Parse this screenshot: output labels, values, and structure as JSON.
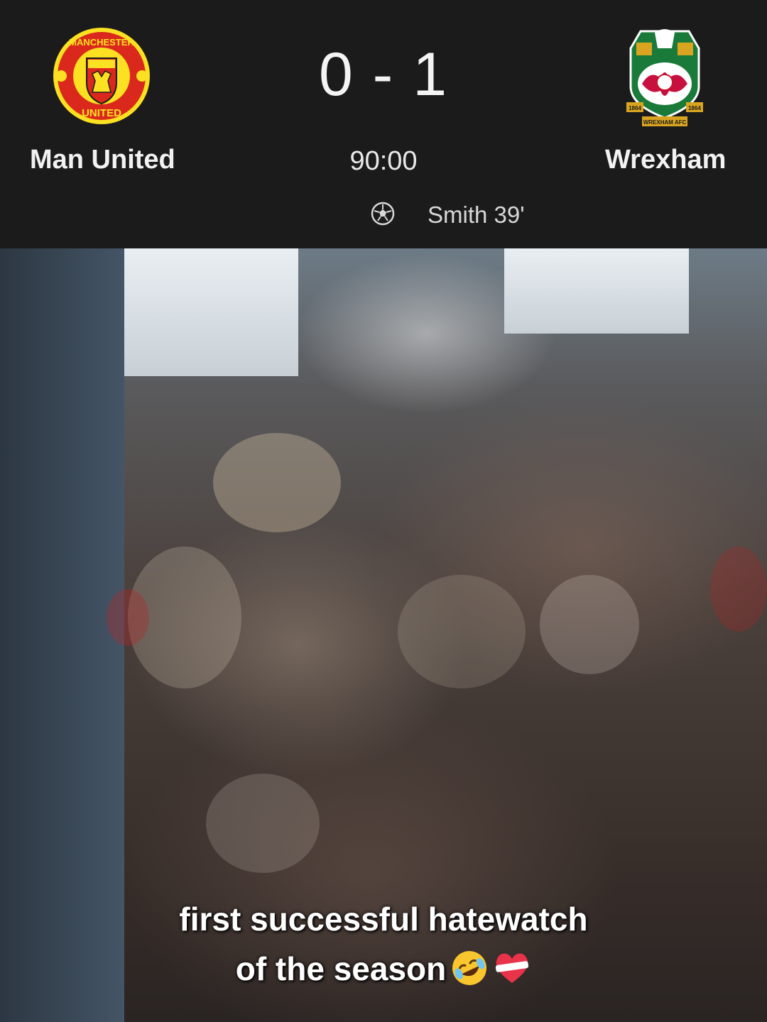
{
  "scoreboard": {
    "home_team": "Man United",
    "away_team": "Wrexham",
    "score": "0 - 1",
    "clock": "90:00",
    "scorer": "Smith 39'",
    "home_crest": {
      "icon": "manchester-united-crest-icon",
      "top_text": "MANCHESTER",
      "bottom_text": "UNITED",
      "colors": {
        "red": "#da291c",
        "yellow": "#fbe122",
        "black": "#1a1a1a"
      }
    },
    "away_crest": {
      "icon": "wrexham-afc-crest-icon",
      "year_left": "1864",
      "year_right": "1864",
      "banner": "WREXHAM AFC",
      "colors": {
        "green": "#1a7a3a",
        "red": "#c8102e",
        "white": "#ffffff",
        "gold": "#d9a520"
      }
    },
    "goal_icon": "soccer-ball-icon",
    "background": "#1b1b1b"
  },
  "video": {
    "caption_line1": "first successful hatewatch",
    "caption_line2": "of the season",
    "caption_emojis": [
      "rolling-on-floor-laughing-emoji",
      "mending-heart-emoji"
    ]
  }
}
